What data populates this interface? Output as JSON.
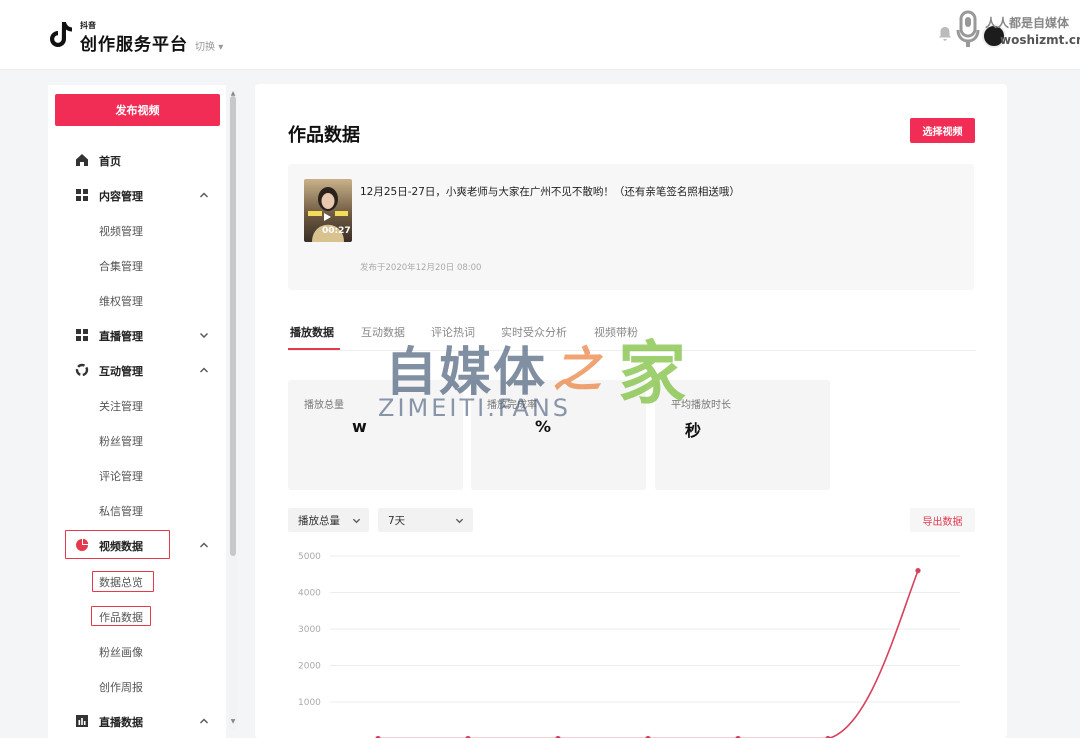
{
  "header": {
    "logo_small": "抖音",
    "app_name": "创作服务平台",
    "switch_label": "切换",
    "watermark_top": "人人都是自媒体",
    "watermark_bottom": "woshizmt.cn"
  },
  "sidebar": {
    "publish_label": "发布视频",
    "items": [
      {
        "label": "首页",
        "icon": "home-icon"
      },
      {
        "label": "内容管理",
        "icon": "grid-icon"
      },
      {
        "label": "视频管理"
      },
      {
        "label": "合集管理"
      },
      {
        "label": "维权管理"
      },
      {
        "label": "直播管理",
        "icon": "grid-icon"
      },
      {
        "label": "互动管理",
        "icon": "interaction-icon"
      },
      {
        "label": "关注管理"
      },
      {
        "label": "粉丝管理"
      },
      {
        "label": "评论管理"
      },
      {
        "label": "私信管理"
      },
      {
        "label": "视频数据",
        "icon": "pie-chart-icon"
      },
      {
        "label": "数据总览"
      },
      {
        "label": "作品数据"
      },
      {
        "label": "粉丝画像"
      },
      {
        "label": "创作周报"
      },
      {
        "label": "直播数据",
        "icon": "bar-chart-icon"
      }
    ]
  },
  "main": {
    "title": "作品数据",
    "select_video_label": "选择视频",
    "video": {
      "title": "12月25日-27日，小爽老师与大家在广州不见不散哟！（还有亲笔签名照相送哦）",
      "duration": "00:27",
      "published": "发布于2020年12月20日 08:00"
    },
    "tabs": [
      "播放数据",
      "互动数据",
      "评论热词",
      "实时受众分析",
      "视频带粉"
    ],
    "stats": [
      {
        "label": "播放总量",
        "value": "w"
      },
      {
        "label": "播放完成率",
        "value": "%"
      },
      {
        "label": "平均播放时长",
        "value": "秒"
      }
    ],
    "metric_select": "播放总量",
    "period_select": "7天",
    "export_label": "导出数据"
  },
  "watermark": {
    "cn": "自媒体",
    "zhi": "之",
    "jia": "家",
    "en": "ZIMEITI.FANS"
  },
  "accent_color": "#f12d55",
  "chart_data": {
    "type": "line",
    "y_ticks": [
      5000,
      4000,
      3000,
      2000,
      1000
    ],
    "ylim": [
      0,
      5000
    ],
    "series": [
      {
        "values": [
          0,
          0,
          0,
          0,
          0,
          0,
          4600
        ]
      }
    ]
  }
}
